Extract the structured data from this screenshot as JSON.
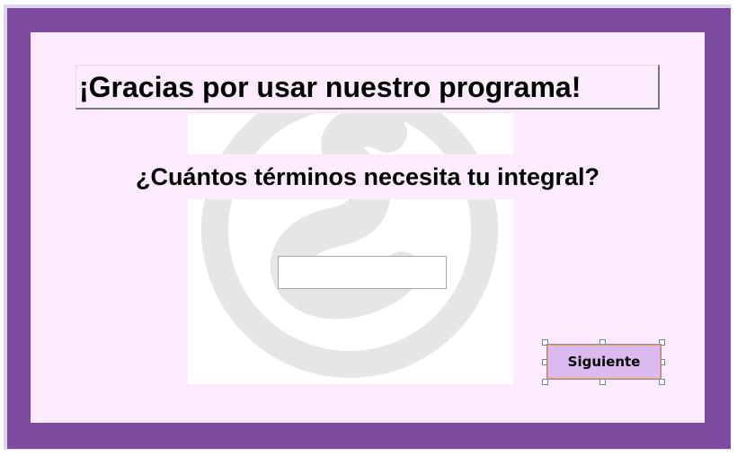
{
  "window": {
    "title": "¡Gracias por usar nuestro programa!",
    "question": "¿Cuántos términos necesita tu integral?"
  },
  "answer_input": {
    "value": "",
    "placeholder": ""
  },
  "next_button": {
    "label": "Siguiente"
  },
  "watermark": {
    "icon": "integral-logo-watermark"
  },
  "colors": {
    "frame": "#7c4b9f",
    "panel": "#fcebfc",
    "button": "#dcbaf0",
    "button_border": "#e2a83a"
  }
}
